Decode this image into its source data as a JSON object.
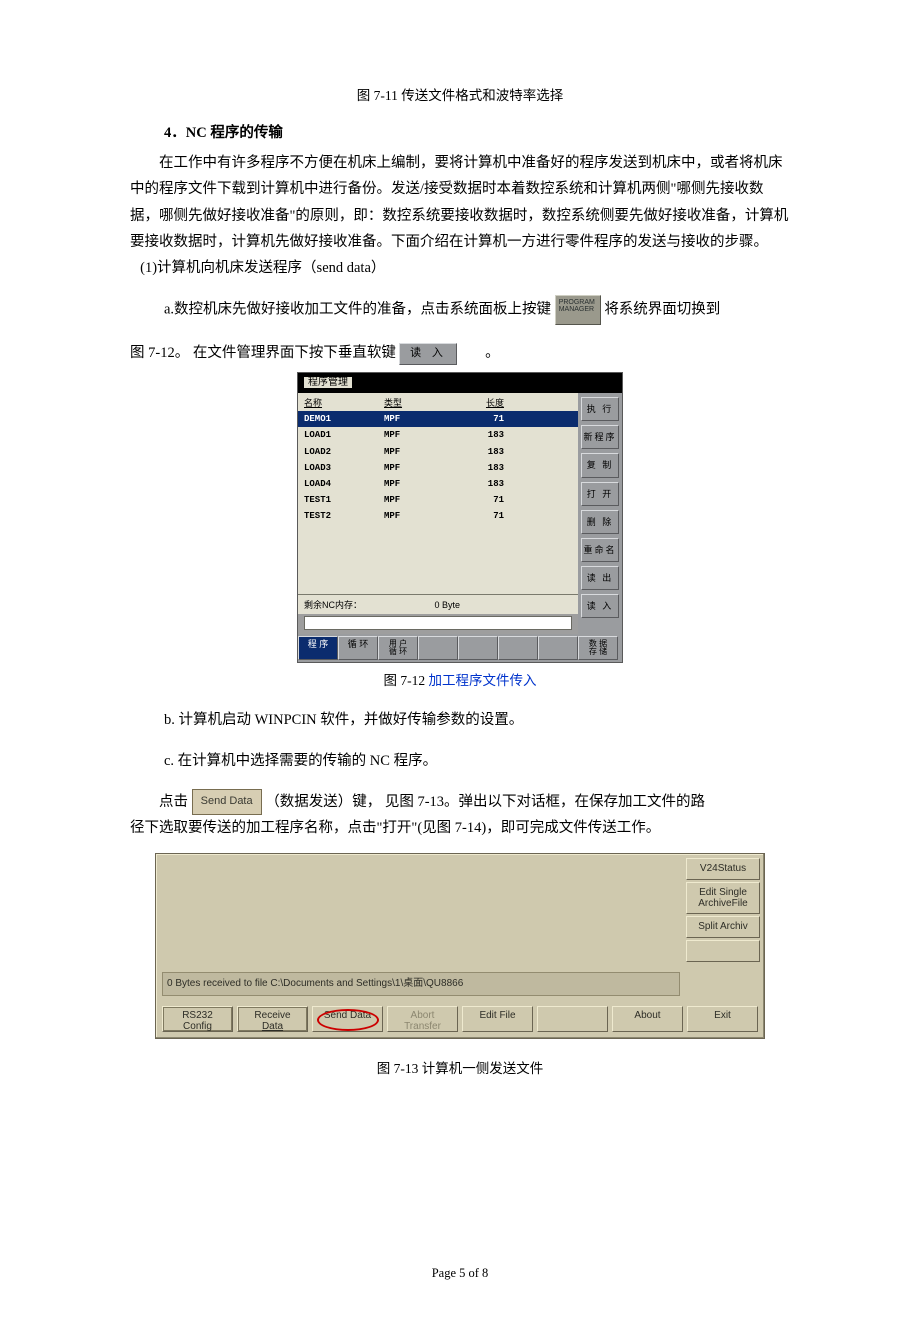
{
  "caption_711": "图 7-11  传送文件格式和波特率选择",
  "h4": "4．NC 程序的传输",
  "p1": "在工作中有许多程序不方便在机床上编制，要将计算机中准备好的程序发送到机床中，或者将机床中的程序文件下载到计算机中进行备份。发送/接受数据时本着数控系统和计算机两侧\"哪侧先接收数据，哪侧先做好接收准备\"的原则，即：数控系统要接收数据时，数控系统侧要先做好接收准备，计算机要接收数据时，计算机先做好接收准备。下面介绍在计算机一方进行零件程序的发送与接收的步骤。",
  "p_send": "(1)计算机向机床发送程序（send data）",
  "p_a1_pre": "a.数控机床先做好接收加工文件的准备，点击系统面板上按键",
  "p_a1_post": "将系统界面切换到",
  "pm_line1": "PROGRAM",
  "pm_line2": "MANAGER",
  "p_a2_pre": "图 7-12。  在文件管理界面下按下垂直软键",
  "read_label": "读  入",
  "p_a2_post": "。",
  "cnc": {
    "title": "程序管理",
    "headers": {
      "name": "名称",
      "type": "类型",
      "length": "长度"
    },
    "rows": [
      {
        "name": "DEMO1",
        "type": "MPF",
        "length": "71",
        "selected": true
      },
      {
        "name": "LOAD1",
        "type": "MPF",
        "length": "183"
      },
      {
        "name": "LOAD2",
        "type": "MPF",
        "length": "183"
      },
      {
        "name": "LOAD3",
        "type": "MPF",
        "length": "183"
      },
      {
        "name": "LOAD4",
        "type": "MPF",
        "length": "183"
      },
      {
        "name": "TEST1",
        "type": "MPF",
        "length": "71"
      },
      {
        "name": "TEST2",
        "type": "MPF",
        "length": "71"
      }
    ],
    "mem_label": "剩余NC内存：",
    "mem_value": "0 Byte",
    "side": [
      "执 行",
      "新程序",
      "复 制",
      "打 开",
      "删 除",
      "重命名",
      "读 出",
      "读 入"
    ],
    "bottom_active": "程 序",
    "bottom_b1": "循 环",
    "bottom_b2a": "用 户",
    "bottom_b2b": "循 环",
    "bottom_r1": "数 据",
    "bottom_r2": "存 储"
  },
  "caption_712_a": "图  7-12 ",
  "caption_712_b": "加工程序文件传入",
  "p_b": "b.  计算机启动 WINPCIN 软件，并做好传输参数的设置。",
  "p_c": "c.  在计算机中选择需要的传输的 NC 程序。",
  "p_click_pre": "点击",
  "send_label": "Send Data",
  "p_click_post": "（数据发送）键，  见图 7-13。弹出以下对话框，在保存加工文件的路",
  "p_click_next": "径下选取要传送的加工程序名称，点击\"打开\"(见图 7-14)，即可完成文件传送工作。",
  "pcin": {
    "status": "0 Bytes received to file C:\\Documents and Settings\\1\\桌面\\QU8866",
    "side": [
      "V24Status",
      "Edit Single ArchiveFile",
      "Split Archiv",
      ""
    ],
    "bottom": [
      {
        "l1": "RS232",
        "l2": "Config",
        "cls": "dashed"
      },
      {
        "l1": "Receive",
        "l2": "Data",
        "cls": "dashed"
      },
      {
        "l1": "Send Data",
        "l2": "",
        "cls": "circ"
      },
      {
        "l1": "Abort",
        "l2": "Transfer",
        "cls": "disabled"
      },
      {
        "l1": "Edit File",
        "l2": ""
      },
      {
        "l1": "",
        "l2": ""
      },
      {
        "l1": "About",
        "l2": ""
      },
      {
        "l1": "Exit",
        "l2": ""
      }
    ]
  },
  "caption_713": "图 7-13  计算机一侧发送文件",
  "pager": "Page 5 of 8"
}
